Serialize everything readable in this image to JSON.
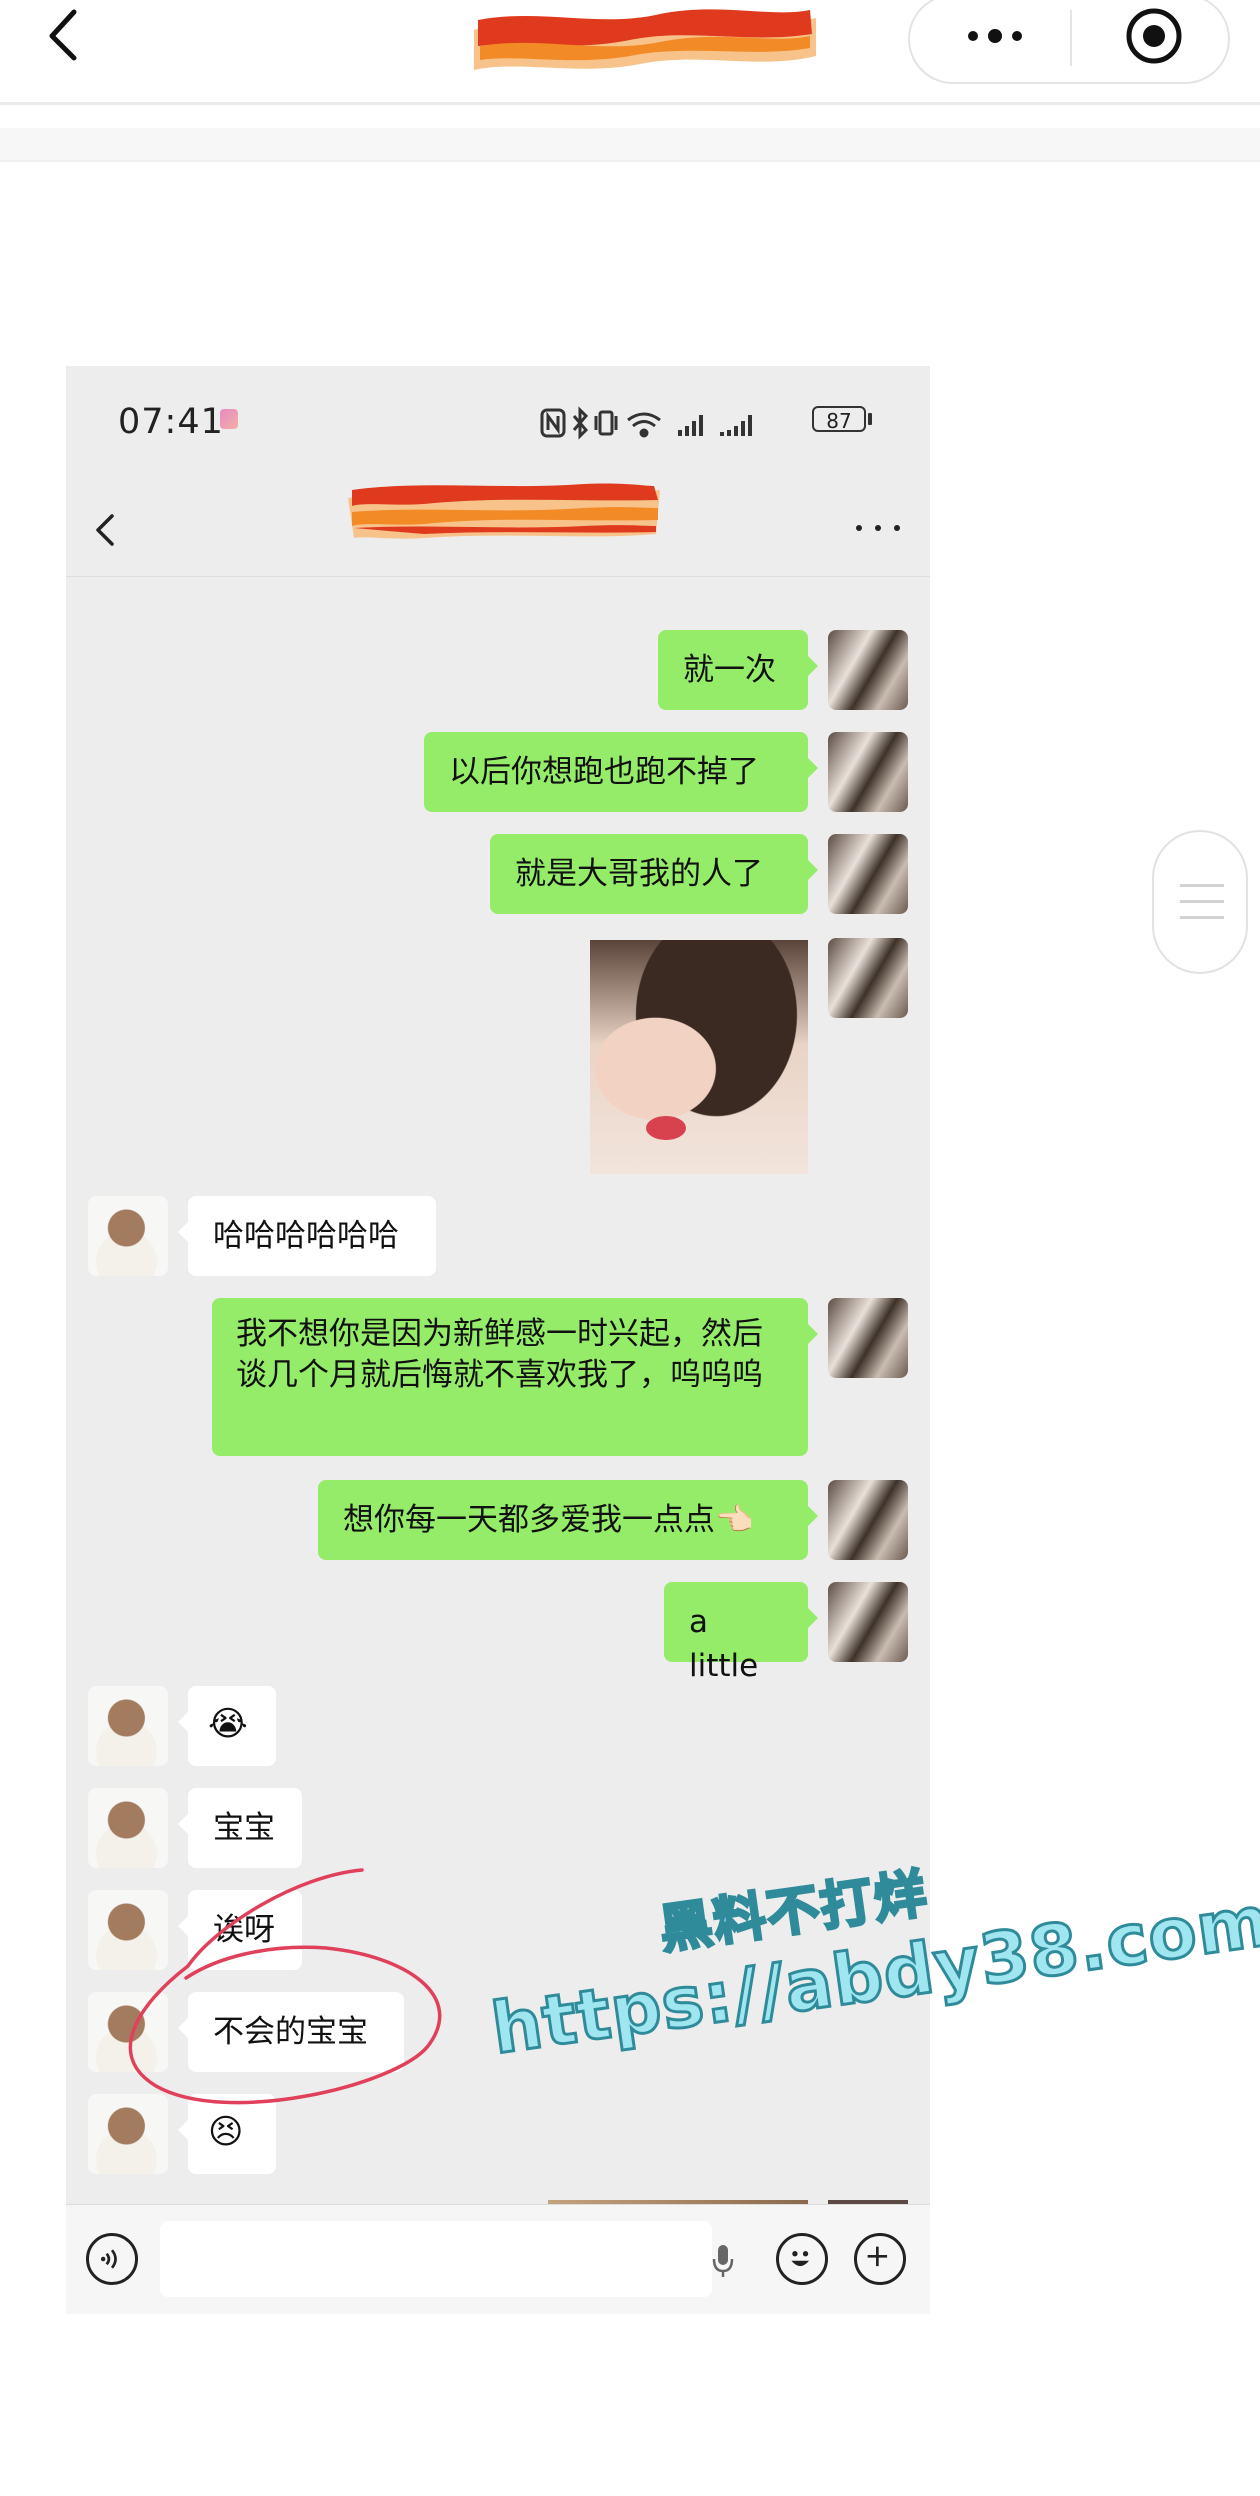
{
  "outer": {
    "icons": {
      "back": "chevron-left-icon",
      "more": "more-dots-icon",
      "close": "target-circle-icon"
    }
  },
  "chat": {
    "status_time": "07:41",
    "battery": "87",
    "status_icons": [
      "nfc-icon",
      "bluetooth-icon",
      "vibrate-icon",
      "wifi-icon",
      "signal-icon",
      "signal-icon-2"
    ],
    "nav_more": "more-dots-icon",
    "messages": [
      {
        "side": "me",
        "type": "text",
        "text": "就一次"
      },
      {
        "side": "me",
        "type": "text",
        "text": "以后你想跑也跑不掉了"
      },
      {
        "side": "me",
        "type": "text",
        "text": "就是大哥我的人了"
      },
      {
        "side": "me",
        "type": "image"
      },
      {
        "side": "other",
        "type": "text",
        "text": "哈哈哈哈哈哈"
      },
      {
        "side": "me",
        "type": "text",
        "text": "我不想你是因为新鲜感一时兴起，然后谈几个月就后悔就不喜欢我了，呜呜呜"
      },
      {
        "side": "me",
        "type": "text",
        "text": "想你每一天都多爱我一点点👈🏻"
      },
      {
        "side": "me",
        "type": "text",
        "text": "a little"
      },
      {
        "side": "other",
        "type": "text",
        "text": "😭"
      },
      {
        "side": "other",
        "type": "text",
        "text": "宝宝"
      },
      {
        "side": "other",
        "type": "text",
        "text": "诶呀"
      },
      {
        "side": "other",
        "type": "text",
        "text": "不会的宝宝"
      },
      {
        "side": "other",
        "type": "text",
        "text": "😣"
      }
    ]
  },
  "watermark": {
    "line1": "黑料不打烊",
    "line2": "https://abdy38.com"
  },
  "colors": {
    "my_bubble": "#95ec69",
    "other_bubble": "#ffffff",
    "chat_bg": "#ededed",
    "annotation": "#e0405a",
    "watermark_fill": "#9fe6f0",
    "watermark_stroke": "#2f8b9a"
  }
}
